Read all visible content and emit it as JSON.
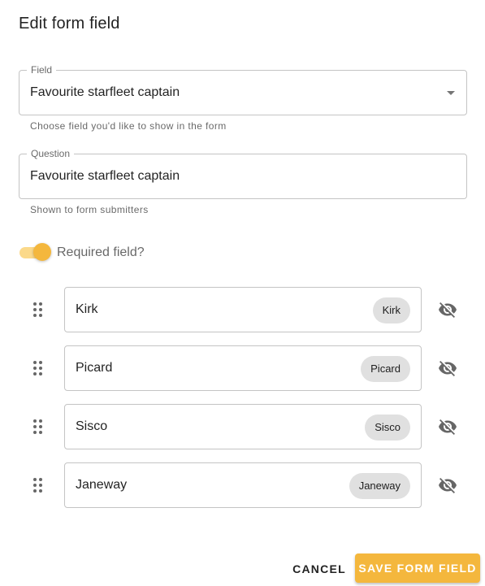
{
  "dialog": {
    "title": "Edit form field"
  },
  "field_select": {
    "label": "Field",
    "value": "Favourite starfleet captain",
    "helper": "Choose field you'd like to show in the form",
    "icon": "arrow-drop-down-icon"
  },
  "question_input": {
    "label": "Question",
    "value": "Favourite starfleet captain",
    "helper": "Shown to form submitters"
  },
  "required_switch": {
    "label": "Required field?",
    "checked": true
  },
  "options": [
    {
      "text": "Kirk",
      "chip": "Kirk",
      "visibility_icon": "eye-off-icon"
    },
    {
      "text": "Picard",
      "chip": "Picard",
      "visibility_icon": "eye-off-icon"
    },
    {
      "text": "Sisco",
      "chip": "Sisco",
      "visibility_icon": "eye-off-icon"
    },
    {
      "text": "Janeway",
      "chip": "Janeway",
      "visibility_icon": "eye-off-icon"
    }
  ],
  "actions": {
    "cancel_label": "CANCEL",
    "save_label": "SAVE FORM FIELD"
  },
  "colors": {
    "accent": "#f4b73d",
    "accent_track": "#fbd98a",
    "chip_bg": "#e0e0e0"
  }
}
